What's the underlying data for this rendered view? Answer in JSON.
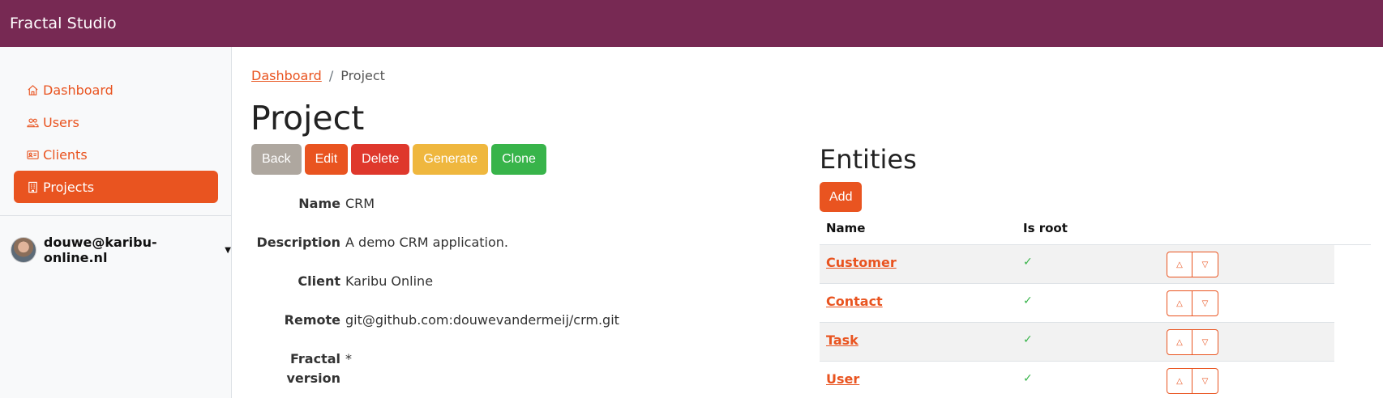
{
  "app": {
    "title": "Fractal Studio"
  },
  "sidebar": {
    "items": [
      {
        "label": "Dashboard",
        "icon": "house-icon",
        "active": false
      },
      {
        "label": "Users",
        "icon": "people-icon",
        "active": false
      },
      {
        "label": "Clients",
        "icon": "person-vcard-icon",
        "active": false
      },
      {
        "label": "Projects",
        "icon": "building-icon",
        "active": true
      }
    ],
    "user": {
      "email": "douwe@karibu-online.nl"
    }
  },
  "breadcrumb": {
    "parent": "Dashboard",
    "separator": "/",
    "current": "Project"
  },
  "page": {
    "title": "Project"
  },
  "actions": {
    "back": "Back",
    "edit": "Edit",
    "delete": "Delete",
    "generate": "Generate",
    "clone": "Clone"
  },
  "details": {
    "name_label": "Name",
    "name": "CRM",
    "description_label": "Description",
    "description": "A demo CRM application.",
    "client_label": "Client",
    "client": "Karibu Online",
    "remote_label": "Remote",
    "remote": "git@github.com:douwevandermeij/crm.git",
    "fractal_version_label_1": "Fractal",
    "fractal_version_label_2": "version",
    "fractal_version": "*"
  },
  "entities": {
    "title": "Entities",
    "add_label": "Add",
    "columns": {
      "name": "Name",
      "is_root": "Is root"
    },
    "rows": [
      {
        "name": "Customer",
        "is_root": "✓"
      },
      {
        "name": "Contact",
        "is_root": "✓"
      },
      {
        "name": "Task",
        "is_root": "✓"
      },
      {
        "name": "User",
        "is_root": "✓"
      }
    ]
  },
  "colors": {
    "topbar": "#772953",
    "accent": "#e95420",
    "danger": "#df382c",
    "warning": "#efb73e",
    "success": "#38b44a",
    "secondary": "#aea79f"
  }
}
